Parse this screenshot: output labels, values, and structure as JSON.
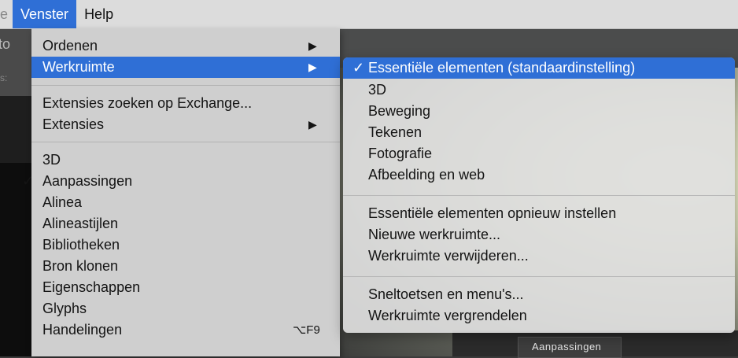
{
  "menubar": {
    "partial_label": "e",
    "venster_label": "Venster",
    "help_label": "Help"
  },
  "background": {
    "left_glyph": "to",
    "left_small": "s:",
    "bottom_tab_label": "Aanpassingen"
  },
  "menu": {
    "items": [
      {
        "label": "Ordenen",
        "submenu": true
      },
      {
        "label": "Werkruimte",
        "submenu": true,
        "active": true
      },
      {
        "label": "Extensies zoeken op Exchange..."
      },
      {
        "label": "Extensies",
        "submenu": true
      },
      {
        "label": "3D"
      },
      {
        "label": "Aanpassingen",
        "checked": true
      },
      {
        "label": "Alinea"
      },
      {
        "label": "Alineastijlen"
      },
      {
        "label": "Bibliotheken"
      },
      {
        "label": "Bron klonen"
      },
      {
        "label": "Eigenschappen"
      },
      {
        "label": "Glyphs"
      },
      {
        "label": "Handelingen",
        "shortcut": "⌥F9"
      }
    ],
    "arrow_glyph": "▶",
    "check_glyph": "✓"
  },
  "submenu": {
    "items": [
      {
        "label": "Essentiële elementen (standaardinstelling)",
        "checked": true,
        "active": true
      },
      {
        "label": "3D"
      },
      {
        "label": "Beweging"
      },
      {
        "label": "Tekenen"
      },
      {
        "label": "Fotografie"
      },
      {
        "label": "Afbeelding en web"
      },
      {
        "label": "Essentiële elementen opnieuw instellen"
      },
      {
        "label": "Nieuwe werkruimte..."
      },
      {
        "label": "Werkruimte verwijderen..."
      },
      {
        "label": "Sneltoetsen en menu's..."
      },
      {
        "label": "Werkruimte vergrendelen"
      }
    ]
  },
  "colors": {
    "accent": "#2f6fd6",
    "menu_bg": "#cfcfcf",
    "menubar_bg": "#dcdcdc"
  }
}
